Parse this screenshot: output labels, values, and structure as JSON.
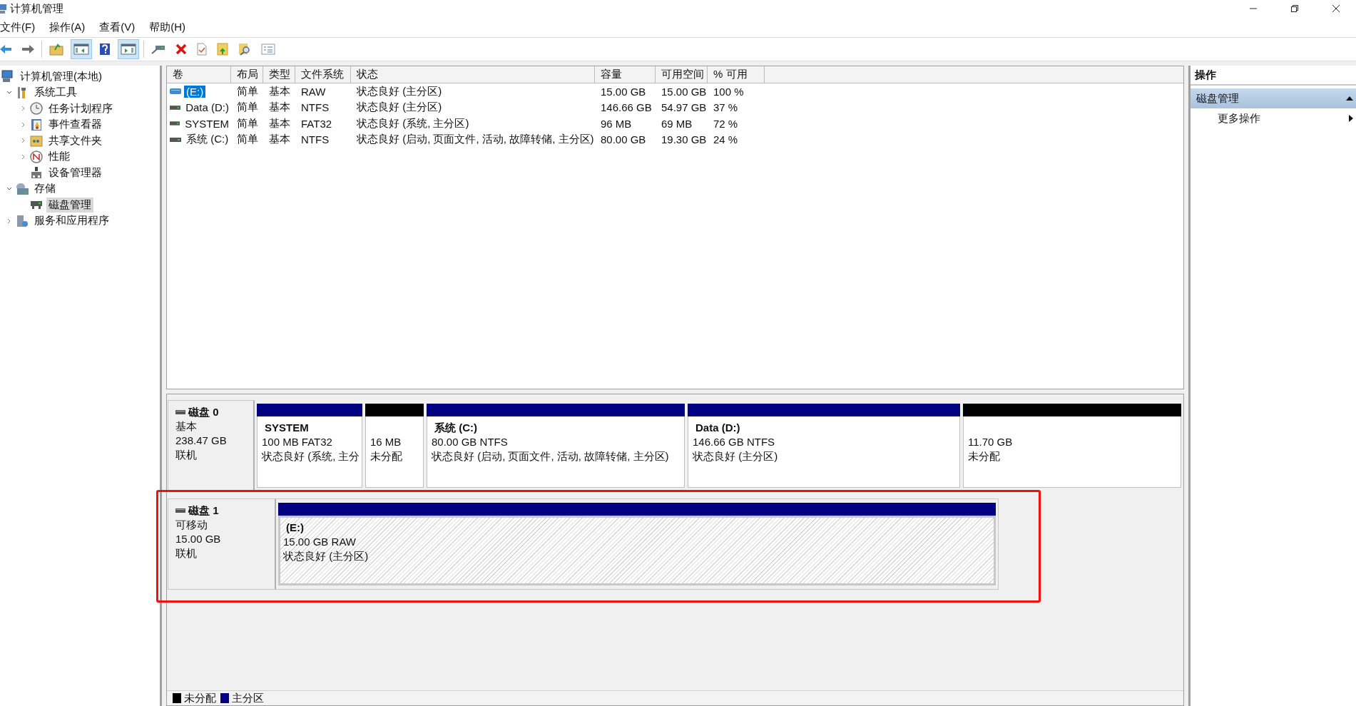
{
  "window": {
    "title": "计算机管理"
  },
  "menu": [
    "文件(F)",
    "操作(A)",
    "查看(V)",
    "帮助(H)"
  ],
  "toolbar": {
    "show_tree": true,
    "show_actions": true
  },
  "tree": [
    {
      "label": "计算机管理(本地)",
      "kind": "computer",
      "selected": false,
      "children": [
        {
          "label": "系统工具",
          "kind": "tools",
          "expanded": true,
          "selected": false,
          "children": [
            {
              "label": "任务计划程序",
              "kind": "clock",
              "expanded": false,
              "selected": false
            },
            {
              "label": "事件查看器",
              "kind": "log",
              "expanded": false,
              "selected": false
            },
            {
              "label": "共享文件夹",
              "kind": "share",
              "expanded": false,
              "selected": false
            },
            {
              "label": "性能",
              "kind": "perf",
              "expanded": false,
              "selected": false
            },
            {
              "label": "设备管理器",
              "kind": "device",
              "selected": false
            }
          ]
        },
        {
          "label": "存储",
          "kind": "storage",
          "expanded": true,
          "selected": false,
          "children": [
            {
              "label": "磁盘管理",
              "kind": "disk",
              "selected": true
            }
          ]
        },
        {
          "label": "服务和应用程序",
          "kind": "services",
          "expanded": false,
          "selected": false
        }
      ]
    }
  ],
  "volumes": {
    "columns": [
      "卷",
      "布局",
      "类型",
      "文件系统",
      "状态",
      "容量",
      "可用空间",
      "% 可用"
    ],
    "rows": [
      {
        "kind": "removable",
        "selected": true,
        "cells": [
          "(E:)",
          "简单",
          "基本",
          "RAW",
          "状态良好 (主分区)",
          "15.00 GB",
          "15.00 GB",
          "100 %"
        ]
      },
      {
        "kind": "fixed",
        "selected": false,
        "cells": [
          "Data (D:)",
          "简单",
          "基本",
          "NTFS",
          "状态良好 (主分区)",
          "146.66 GB",
          "54.97 GB",
          "37 %"
        ]
      },
      {
        "kind": "fixed",
        "selected": false,
        "cells": [
          "SYSTEM",
          "简单",
          "基本",
          "FAT32",
          "状态良好 (系统, 主分区)",
          "96 MB",
          "69 MB",
          "72 %"
        ]
      },
      {
        "kind": "fixed",
        "selected": false,
        "cells": [
          "系统 (C:)",
          "简单",
          "基本",
          "NTFS",
          "状态良好 (启动, 页面文件, 活动, 故障转储, 主分区)",
          "80.00 GB",
          "19.30 GB",
          "24 %"
        ]
      }
    ]
  },
  "disks": [
    {
      "name": "磁盘 0",
      "type": "基本",
      "size": "238.47 GB",
      "status": "联机",
      "highlighted": false,
      "partitions": [
        {
          "name": "SYSTEM",
          "size": "100 MB FAT32",
          "status": "状态良好 (系统, 主分",
          "color": "#000080",
          "selected": false
        },
        {
          "size": "16 MB",
          "status": "未分配",
          "color": "#000000",
          "selected": false
        },
        {
          "name": "系统  (C:)",
          "size": "80.00 GB NTFS",
          "status": "状态良好 (启动, 页面文件, 活动, 故障转储, 主分区)",
          "color": "#000080",
          "selected": false
        },
        {
          "name": "Data  (D:)",
          "size": "146.66 GB NTFS",
          "status": "状态良好 (主分区)",
          "color": "#000080",
          "selected": false
        },
        {
          "size": "11.70 GB",
          "status": "未分配",
          "color": "#000000",
          "selected": false
        }
      ]
    },
    {
      "name": "磁盘 1",
      "type": "可移动",
      "size": "15.00 GB",
      "status": "联机",
      "highlighted": true,
      "partitions": [
        {
          "name": "(E:)",
          "size": "15.00 GB RAW",
          "status": "状态良好 (主分区)",
          "color": "#000080",
          "selected": true
        }
      ]
    }
  ],
  "legend": [
    {
      "label": "未分配",
      "color": "#000000"
    },
    {
      "label": "主分区",
      "color": "#000080"
    }
  ],
  "actions": {
    "title": "操作",
    "groups": [
      {
        "label": "磁盘管理",
        "expanded": true,
        "items": [
          {
            "label": "更多操作",
            "submenu": true
          }
        ]
      }
    ]
  }
}
